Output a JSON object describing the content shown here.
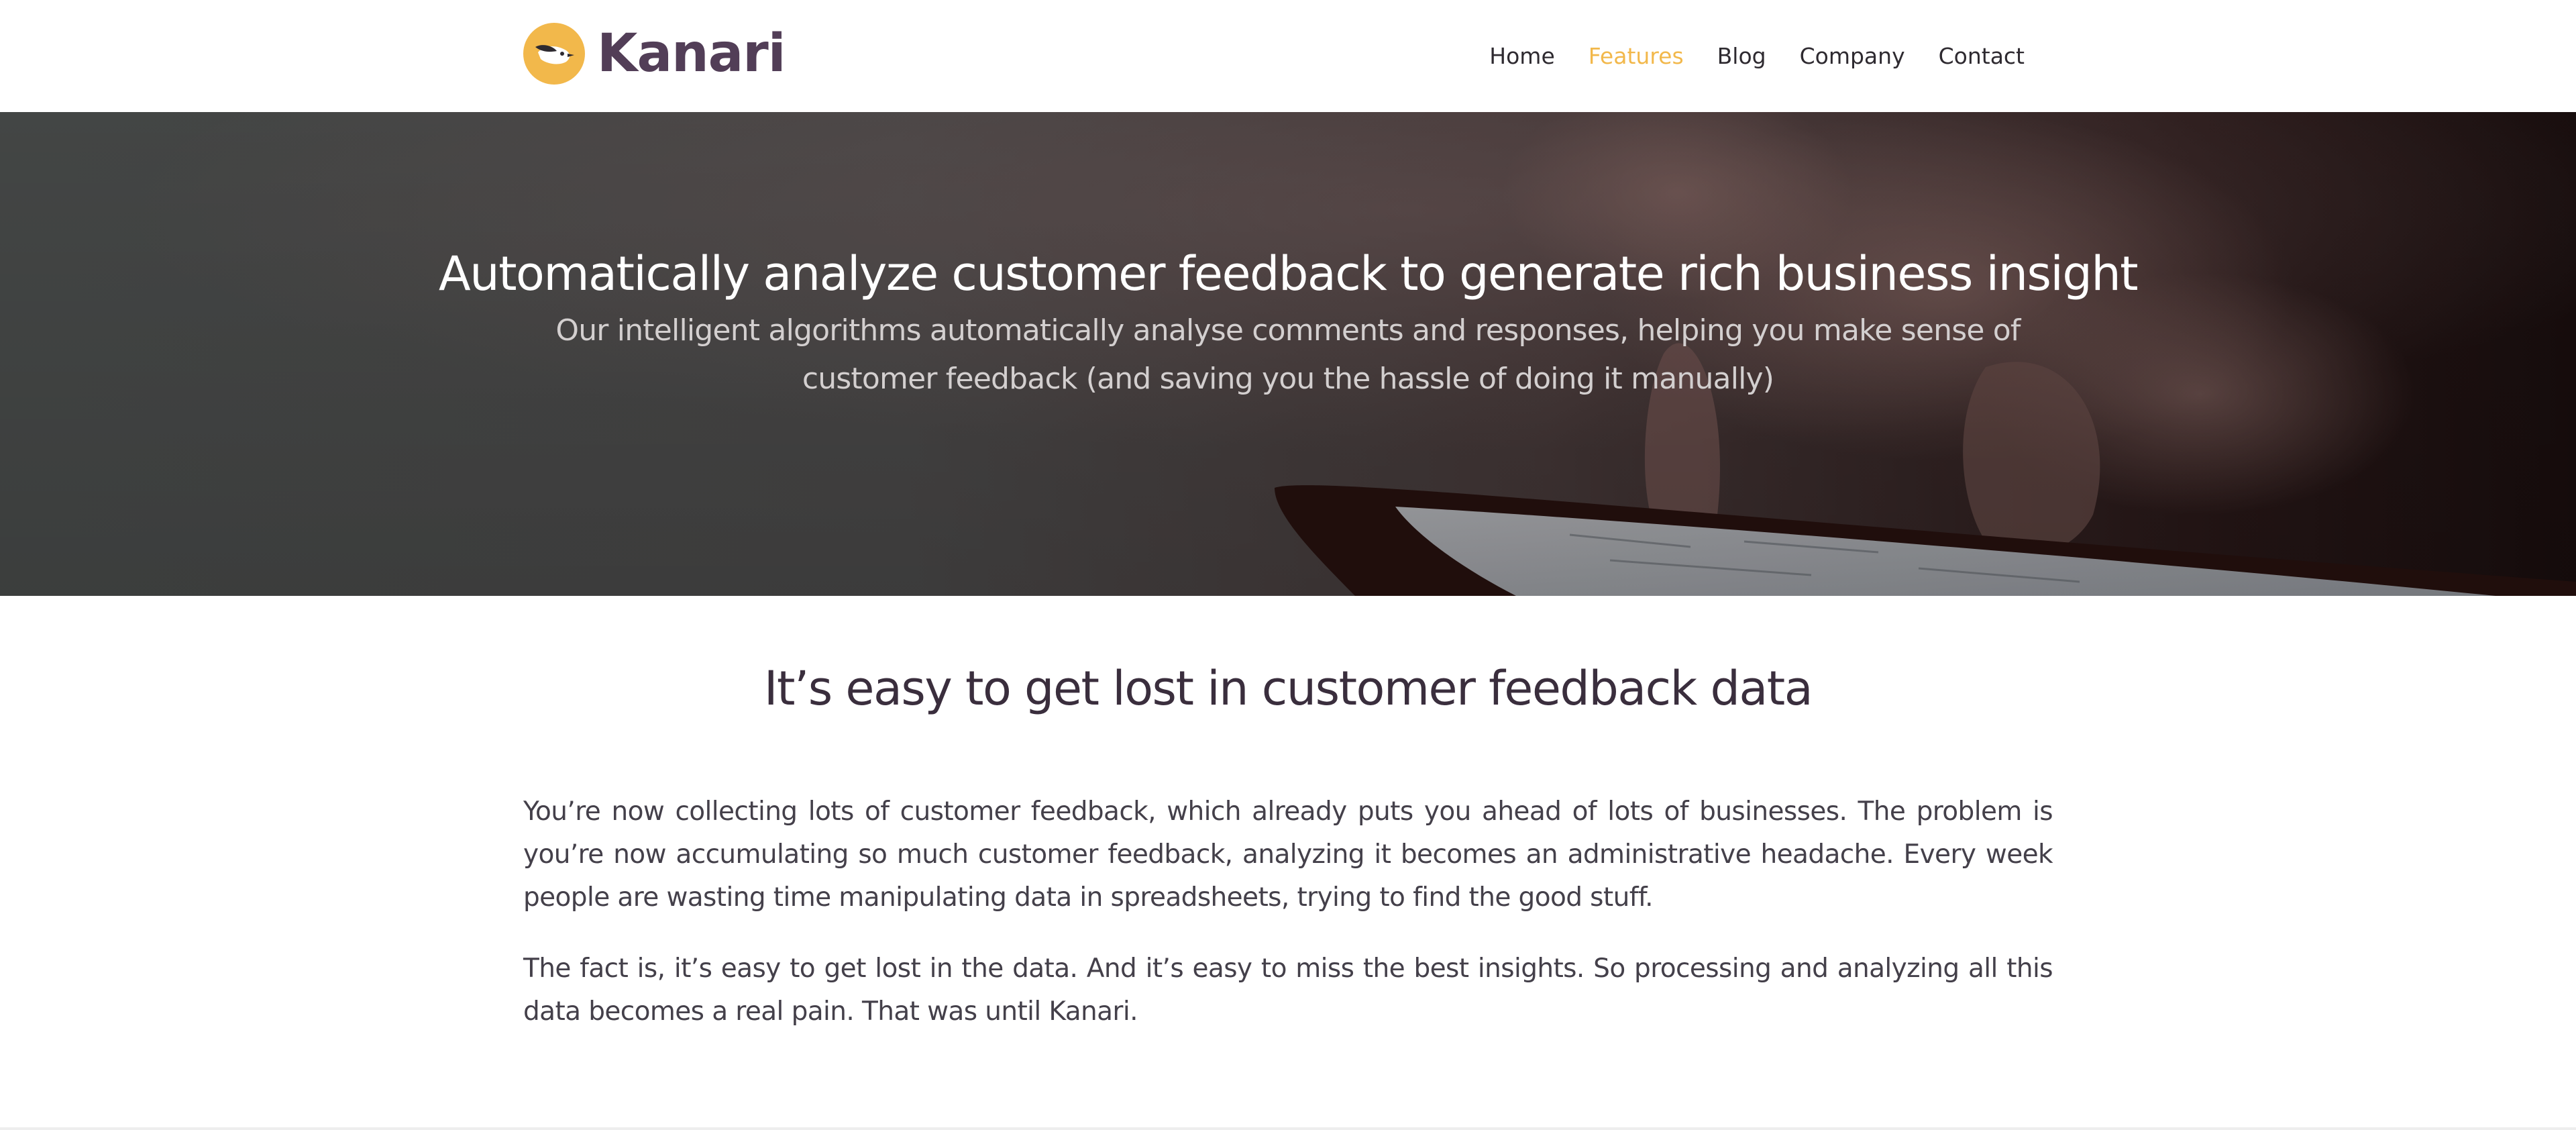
{
  "brand": {
    "name": "Kanari",
    "accent_color": "#f2b84b",
    "logo_text_color": "#523e57",
    "logo_icon": "bird-logo-icon"
  },
  "nav": {
    "items": [
      {
        "label": "Home",
        "active": false
      },
      {
        "label": "Features",
        "active": true
      },
      {
        "label": "Blog",
        "active": false
      },
      {
        "label": "Company",
        "active": false
      },
      {
        "label": "Contact",
        "active": false
      }
    ]
  },
  "hero": {
    "title": "Automatically analyze customer feedback to generate rich business insight",
    "subtitle": "Our intelligent algorithms automatically analyse comments and responses, helping you make sense of customer feedback (and saving you the hassle of doing it manually)"
  },
  "content": {
    "heading": "It’s easy to get lost in customer feedback data",
    "paragraphs": [
      "You’re now collecting lots of customer feedback, which already puts you ahead of lots of businesses. The problem is you’re now accumulating so much customer feedback, analyzing it becomes an administrative headache. Every week people are wasting time manipulating data in spreadsheets, trying to find the good stuff.",
      "The fact is, it’s easy to get lost in the data. And it’s easy to miss the best insights. So processing and analyzing all this data becomes a real pain. That was until Kanari."
    ]
  }
}
